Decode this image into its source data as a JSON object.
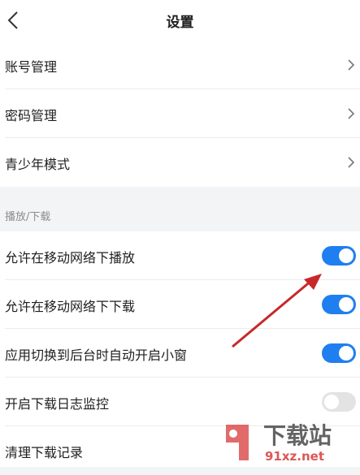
{
  "header": {
    "title": "设置",
    "back_icon": "chevron-left-icon"
  },
  "account_section": {
    "items": [
      {
        "label": "账号管理"
      },
      {
        "label": "密码管理"
      },
      {
        "label": "青少年模式"
      }
    ]
  },
  "playback_section": {
    "title": "播放/下载",
    "items": [
      {
        "label": "允许在移动网络下播放",
        "enabled": true
      },
      {
        "label": "允许在移动网络下下载",
        "enabled": true
      },
      {
        "label": "应用切换到后台时自动开启小窗",
        "enabled": true
      },
      {
        "label": "开启下载日志监控",
        "enabled": false
      },
      {
        "label": "清理下载记录"
      }
    ]
  },
  "colors": {
    "accent": "#1f7ff0",
    "arrow": "#c8282a",
    "watermark_red": "#d73a3a"
  },
  "watermark": {
    "brand": "下载站",
    "url": "91xz.net"
  }
}
